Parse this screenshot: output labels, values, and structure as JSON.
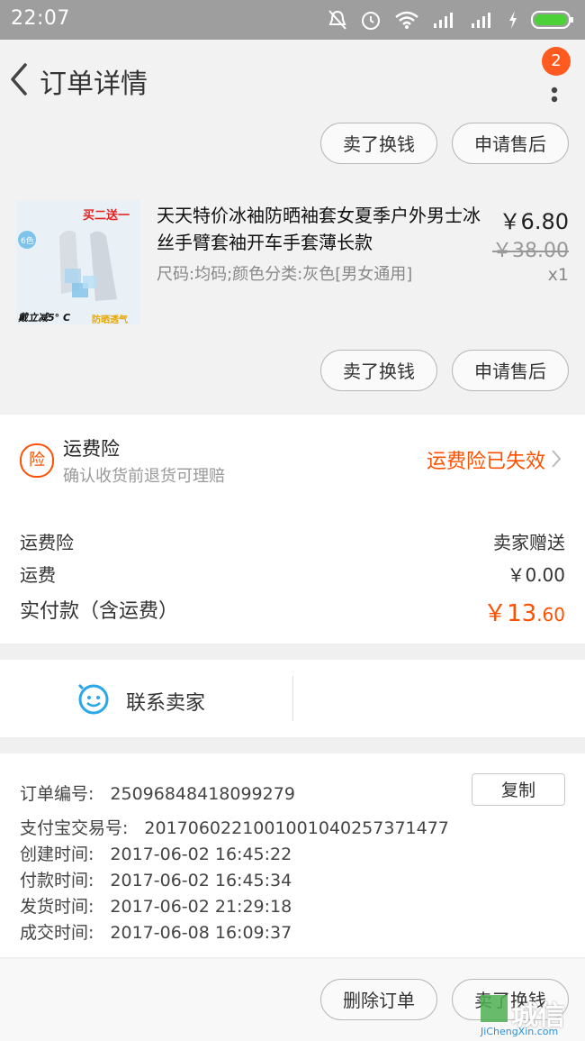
{
  "status": {
    "time": "22:07"
  },
  "header": {
    "title": "订单详情",
    "badge_count": "2"
  },
  "actions": {
    "sell_exchange": "卖了换钱",
    "after_sale": "申请售后",
    "delete_order": "删除订单"
  },
  "product": {
    "name": "天天特价冰袖防晒袖套女夏季户外男士冰丝手臂套袖开车手套薄长款",
    "sku": "尺码:均码;颜色分类:灰色[男女通用]",
    "price": "￥6.80",
    "original_price": "￥38.00",
    "quantity": "x1",
    "image_text": {
      "promo": "买二送一",
      "cool": "戴立减5° C",
      "feature": "防晒透气",
      "badge": "6色"
    }
  },
  "insurance": {
    "icon_text": "险",
    "title": "运费险",
    "subtitle": "确认收货前退货可理赔",
    "status": "运费险已失效"
  },
  "summary": {
    "insurance_label": "运费险",
    "insurance_value": "卖家赠送",
    "shipping_label": "运费",
    "shipping_value": "￥0.00",
    "paid_label": "实付款（含运费）",
    "paid_int": "￥13",
    "paid_dec": ".60"
  },
  "contact": {
    "label": "联系卖家"
  },
  "order_info": {
    "copy_label": "复制",
    "rows": [
      {
        "label": "订单编号:",
        "value": "25096848418099279"
      },
      {
        "label": "支付宝交易号:",
        "value": "2017060221001001040257371477"
      },
      {
        "label": "创建时间:",
        "value": "2017-06-02 16:45:22"
      },
      {
        "label": "付款时间:",
        "value": "2017-06-02 16:45:34"
      },
      {
        "label": "发货时间:",
        "value": "2017-06-02 21:29:18"
      },
      {
        "label": "成交时间:",
        "value": "2017-06-08 16:09:37"
      }
    ]
  },
  "watermark": {
    "text": "城信",
    "url": "JiChengXin.com"
  },
  "colors": {
    "accent": "#ff5000",
    "contact_blue": "#2aa7e6"
  }
}
